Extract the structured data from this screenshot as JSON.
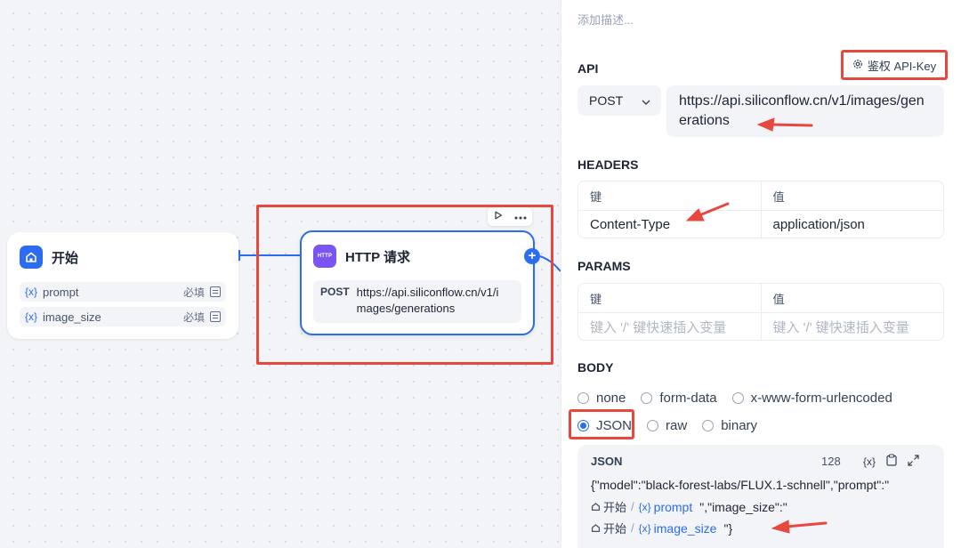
{
  "canvas": {
    "start_node": {
      "title": "开始",
      "variables": [
        {
          "symbol": "{x}",
          "name": "prompt",
          "required": "必填"
        },
        {
          "symbol": "{x}",
          "name": "image_size",
          "required": "必填"
        }
      ]
    },
    "http_node": {
      "icon_text": "HTTP",
      "title": "HTTP 请求",
      "method": "POST",
      "url": "https://api.siliconflow.cn/v1/images/generations"
    },
    "plus_label": "+"
  },
  "panel": {
    "description_placeholder": "添加描述...",
    "api": {
      "title": "API",
      "auth_label": "鉴权 API-Key",
      "method": "POST",
      "url": "https://api.siliconflow.cn/v1/images/generations"
    },
    "headers": {
      "title": "HEADERS",
      "key_header": "键",
      "value_header": "值",
      "rows": [
        {
          "key": "Content-Type",
          "value": "application/json"
        }
      ]
    },
    "params": {
      "title": "PARAMS",
      "key_header": "键",
      "value_header": "值",
      "key_placeholder": "键入 '/' 键快速插入变量",
      "value_placeholder": "键入 '/' 键快速插入变量"
    },
    "body": {
      "title": "BODY",
      "options_row1": [
        "none",
        "form-data",
        "x-www-form-urlencoded"
      ],
      "options_row2": [
        "JSON",
        "raw",
        "binary"
      ],
      "selected": "JSON"
    },
    "json_editor": {
      "title": "JSON",
      "count": "128",
      "var_symbol": "{x}",
      "line1": "{\"model\":\"black-forest-labs/FLUX.1-schnell\",\"prompt\":\"",
      "line2_node": "开始",
      "line2_var": "prompt",
      "line2_suffix": "\",\"image_size\":\"",
      "line3_node": "开始",
      "line3_var": "image_size",
      "line3_suffix": "\"}"
    }
  },
  "colors": {
    "accent": "#2b6cf0",
    "annotation": "#e8473e",
    "http_icon": "#7b55f2"
  }
}
